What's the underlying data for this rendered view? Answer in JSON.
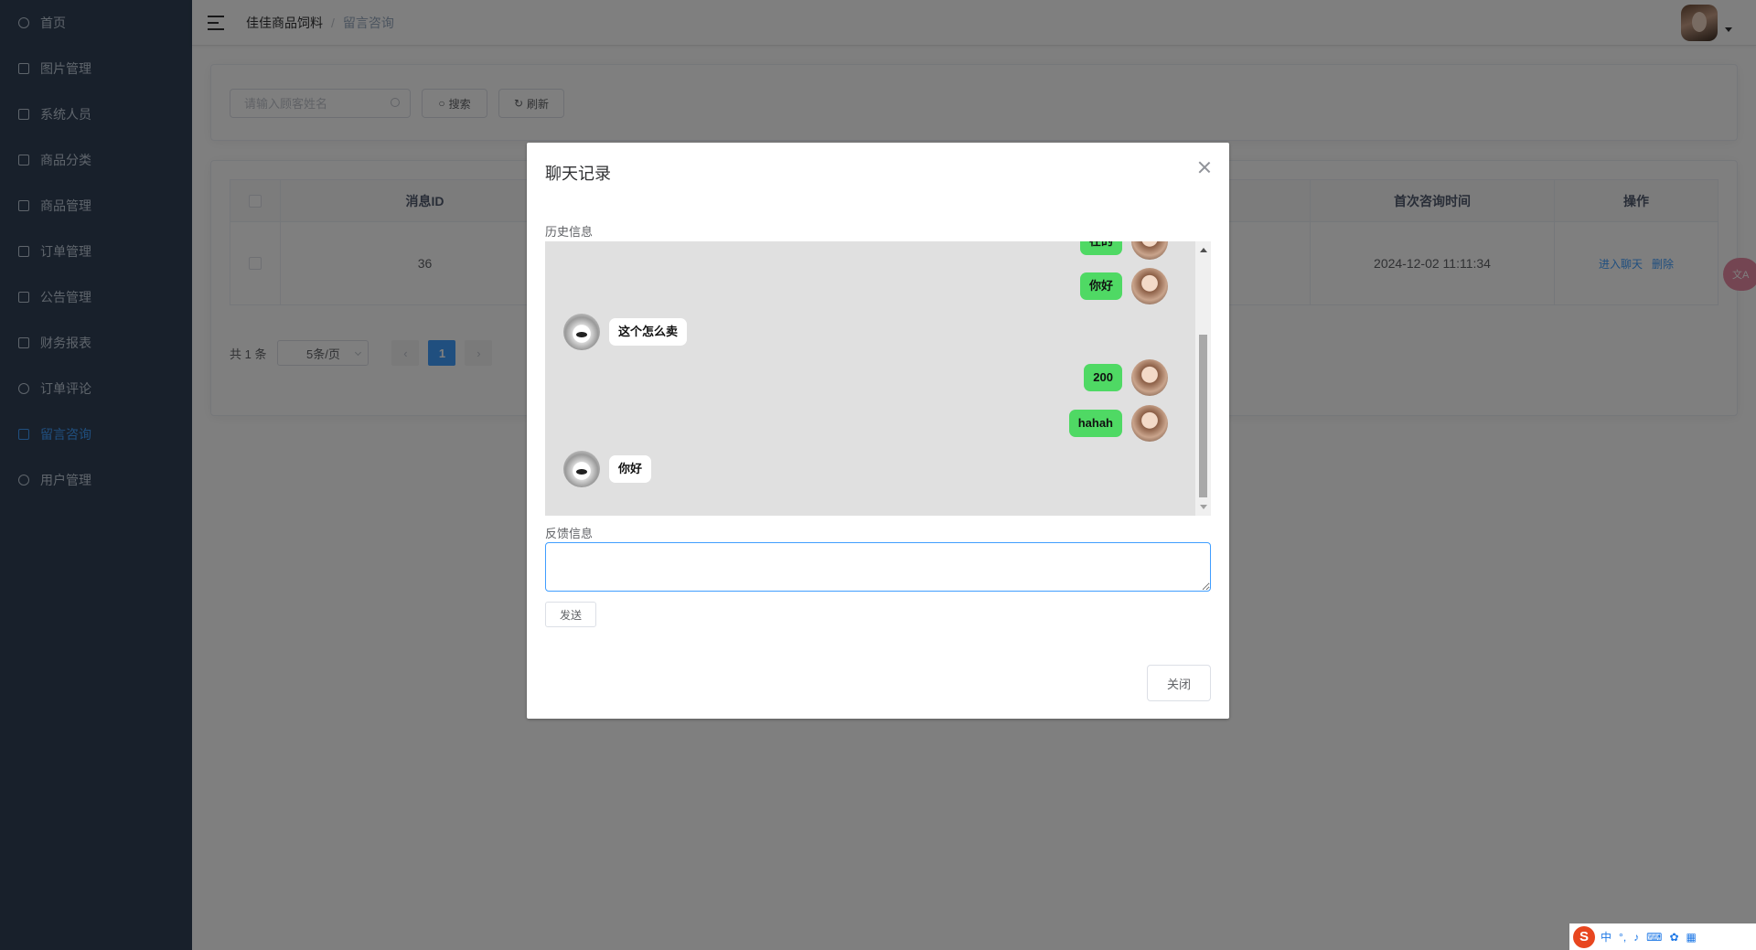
{
  "sidebar": {
    "items": [
      {
        "label": "首页",
        "icon": "dashboard-icon",
        "active": false
      },
      {
        "label": "图片管理",
        "icon": "image-icon",
        "active": false
      },
      {
        "label": "系统人员",
        "icon": "monitor-icon",
        "active": false
      },
      {
        "label": "商品分类",
        "icon": "category-icon",
        "active": false
      },
      {
        "label": "商品管理",
        "icon": "book-icon",
        "active": false
      },
      {
        "label": "订单管理",
        "icon": "cart-icon",
        "active": false
      },
      {
        "label": "公告管理",
        "icon": "notice-icon",
        "active": false
      },
      {
        "label": "财务报表",
        "icon": "chart-icon",
        "active": false
      },
      {
        "label": "订单评论",
        "icon": "comment-icon",
        "active": false
      },
      {
        "label": "留言咨询",
        "icon": "message-icon",
        "active": true
      },
      {
        "label": "用户管理",
        "icon": "user-icon",
        "active": false
      }
    ]
  },
  "navbar": {
    "breadcrumb_root": "佳佳商品饲料",
    "breadcrumb_sep": "/",
    "breadcrumb_current": "留言咨询"
  },
  "search": {
    "placeholder": "请输入顾客姓名",
    "search_label": "搜索",
    "refresh_label": "刷新"
  },
  "table": {
    "headers": {
      "id": "消息ID",
      "first_time": "首次咨询时间",
      "actions": "操作"
    },
    "rows": [
      {
        "id": "36",
        "first_time": "2024-12-02 11:11:34",
        "enter_chat": "进入聊天",
        "delete": "删除"
      }
    ]
  },
  "pagination": {
    "total": "共 1 条",
    "page_size": "5条/页",
    "current_page": "1"
  },
  "dialog": {
    "title": "聊天记录",
    "history_label": "历史信息",
    "messages": [
      {
        "side": "right",
        "text": "在的"
      },
      {
        "side": "right",
        "text": "你好"
      },
      {
        "side": "left",
        "text": "这个怎么卖"
      },
      {
        "side": "right",
        "text": "200"
      },
      {
        "side": "right",
        "text": "hahah"
      },
      {
        "side": "left",
        "text": "你好"
      }
    ],
    "feedback_label": "反馈信息",
    "feedback_value": "",
    "send_label": "发送",
    "close_label": "关闭"
  },
  "ime": {
    "logo": "S",
    "lang": "中"
  },
  "colors": {
    "sidebar_bg": "#304156",
    "accent": "#409eff",
    "bubble_green": "#4fd964",
    "chat_bg": "#e0e0e0"
  }
}
